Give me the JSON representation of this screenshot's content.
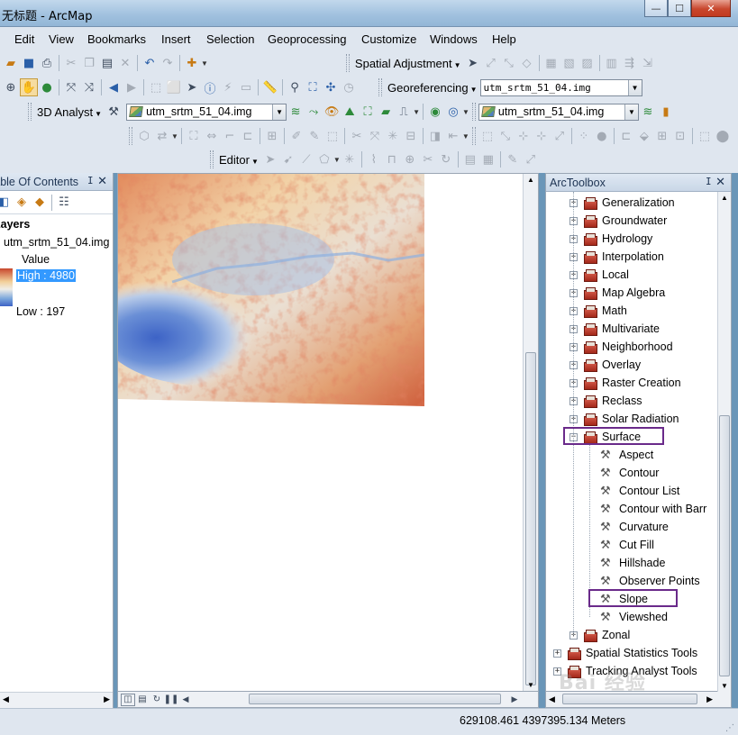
{
  "window": {
    "title": "无标题 - ArcMap",
    "min_glyph": "—",
    "max_glyph": "☐",
    "close_glyph": "✕"
  },
  "menu": [
    "Edit",
    "View",
    "Bookmarks",
    "Insert",
    "Selection",
    "Geoprocessing",
    "Customize",
    "Windows",
    "Help"
  ],
  "toolbars": {
    "spatial_adjustment": "Spatial Adjustment",
    "georeferencing": "Georeferencing",
    "georef_layer": "utm_srtm_51_04.img",
    "analyst_3d": "3D Analyst",
    "analyst_layer": "utm_srtm_51_04.img",
    "analyst_layer2": "utm_srtm_51_04.img",
    "editor": "Editor"
  },
  "toc": {
    "title": "Table Of Contents",
    "layers_label": "Layers",
    "layer_name": "utm_srtm_51_04.img",
    "value_label": "Value",
    "high": "High : 4980",
    "low": "Low : 197"
  },
  "arctoolbox": {
    "title": "ArcToolbox",
    "items": [
      {
        "label": "Generalization",
        "kind": "toolset"
      },
      {
        "label": "Groundwater",
        "kind": "toolset"
      },
      {
        "label": "Hydrology",
        "kind": "toolset"
      },
      {
        "label": "Interpolation",
        "kind": "toolset"
      },
      {
        "label": "Local",
        "kind": "toolset"
      },
      {
        "label": "Map Algebra",
        "kind": "toolset"
      },
      {
        "label": "Math",
        "kind": "toolset"
      },
      {
        "label": "Multivariate",
        "kind": "toolset"
      },
      {
        "label": "Neighborhood",
        "kind": "toolset"
      },
      {
        "label": "Overlay",
        "kind": "toolset"
      },
      {
        "label": "Raster Creation",
        "kind": "toolset"
      },
      {
        "label": "Reclass",
        "kind": "toolset"
      },
      {
        "label": "Solar Radiation",
        "kind": "toolset"
      },
      {
        "label": "Surface",
        "kind": "toolset-open"
      },
      {
        "label": "Aspect",
        "kind": "tool"
      },
      {
        "label": "Contour",
        "kind": "tool"
      },
      {
        "label": "Contour List",
        "kind": "tool"
      },
      {
        "label": "Contour with Barr",
        "kind": "tool"
      },
      {
        "label": "Curvature",
        "kind": "tool"
      },
      {
        "label": "Cut Fill",
        "kind": "tool"
      },
      {
        "label": "Hillshade",
        "kind": "tool"
      },
      {
        "label": "Observer Points",
        "kind": "tool"
      },
      {
        "label": "Slope",
        "kind": "tool"
      },
      {
        "label": "Viewshed",
        "kind": "tool"
      },
      {
        "label": "Zonal",
        "kind": "toolset"
      },
      {
        "label": "Spatial Statistics Tools",
        "kind": "toolbox"
      },
      {
        "label": "Tracking Analyst Tools",
        "kind": "toolbox"
      }
    ]
  },
  "status": {
    "coordinates": "629108.461  4397395.134 Meters"
  },
  "watermark": "Bai 经验",
  "colors": {
    "highlight_box": "#6a2a8a",
    "selection": "#3399ff",
    "dem_high": "#c8472d",
    "dem_low": "#3d63c6"
  }
}
